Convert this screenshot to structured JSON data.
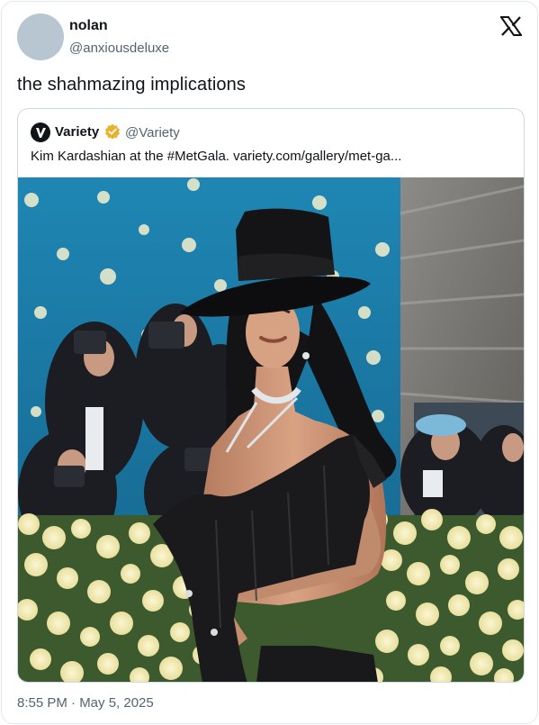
{
  "tweet": {
    "display_name": "nolan",
    "handle": "@anxiousdeluxe",
    "text": "the shahmazing implications",
    "timestamp": "8:55 PM · May 5, 2025"
  },
  "quoted_tweet": {
    "display_name": "Variety",
    "handle": "@Variety",
    "text": "Kim Kardashian at the #MetGala. variety.com/gallery/met-ga...",
    "badge_color": "#e8b12a"
  },
  "icons": {
    "platform_logo": "x-logo-icon",
    "quoted_avatar": "variety-logo-icon",
    "verified": "verified-badge-icon"
  },
  "colors": {
    "secondary_text": "#536471",
    "backdrop": "#1f7ea8"
  }
}
